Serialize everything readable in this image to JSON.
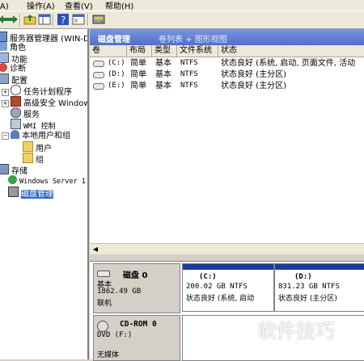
{
  "menu": [
    "作(A)",
    "操作(A)",
    "查看(V)",
    "帮助(H)"
  ],
  "toolbar_icons": [
    "back-icon",
    "forward-icon",
    "up-folder-icon",
    "show-tree-icon",
    "help-icon",
    "properties-icon",
    "disk-icon"
  ],
  "tree": {
    "root": "服务器管理器 (WIN-D1LV",
    "items": [
      {
        "label": "角色",
        "icon": "roles-icon"
      },
      {
        "label": "功能",
        "icon": "features-icon"
      },
      {
        "label": "诊断",
        "icon": "diagnostics-icon"
      },
      {
        "label": "配置",
        "icon": "configuration-icon"
      },
      {
        "label": "任务计划程序",
        "icon": "clock-icon"
      },
      {
        "label": "高级安全 Window",
        "icon": "firewall-icon"
      },
      {
        "label": "服务",
        "icon": "services-icon"
      },
      {
        "label": "WMI 控制",
        "icon": "wmi-icon"
      },
      {
        "label": "本地用户和组",
        "icon": "users-icon"
      },
      {
        "label": "用户",
        "icon": "folder-icon"
      },
      {
        "label": "组",
        "icon": "folder-icon"
      },
      {
        "label": "存储",
        "icon": "storage-icon"
      },
      {
        "label": "Windows Server 1",
        "icon": "backup-icon"
      },
      {
        "label": "磁盘管理",
        "icon": "disk-management-icon"
      }
    ]
  },
  "panel": {
    "title": "磁盘管理",
    "views": "卷列表 + 图形视图"
  },
  "columns": [
    "卷",
    "布局",
    "类型",
    "文件系统",
    "状态"
  ],
  "volumes": [
    {
      "vol": "(C:)",
      "layout": "简单",
      "type": "基本",
      "fs": "NTFS",
      "status": "状态良好 (系统, 启动, 页面文件, 活动"
    },
    {
      "vol": "(D:)",
      "layout": "简单",
      "type": "基本",
      "fs": "NTFS",
      "status": "状态良好 (主分区)"
    },
    {
      "vol": "(E:)",
      "layout": "简单",
      "type": "基本",
      "fs": "NTFS",
      "status": "状态良好 (主分区)"
    }
  ],
  "disks": [
    {
      "name": "磁盘 0",
      "type": "基本",
      "size": "1862.49 GB",
      "state": "联机",
      "partitions": [
        {
          "label": "(C:)",
          "size": "200.02 GB NTFS",
          "status": "状态良好 (系统, 启动"
        },
        {
          "label": "(D:)",
          "size": "831.23 GB NTFS",
          "status": "状态良好 (主分区)"
        }
      ]
    },
    {
      "name": "CD-ROM 0",
      "type": "DVD (F:)",
      "state": "无媒体"
    }
  ],
  "watermark": "软件技巧"
}
